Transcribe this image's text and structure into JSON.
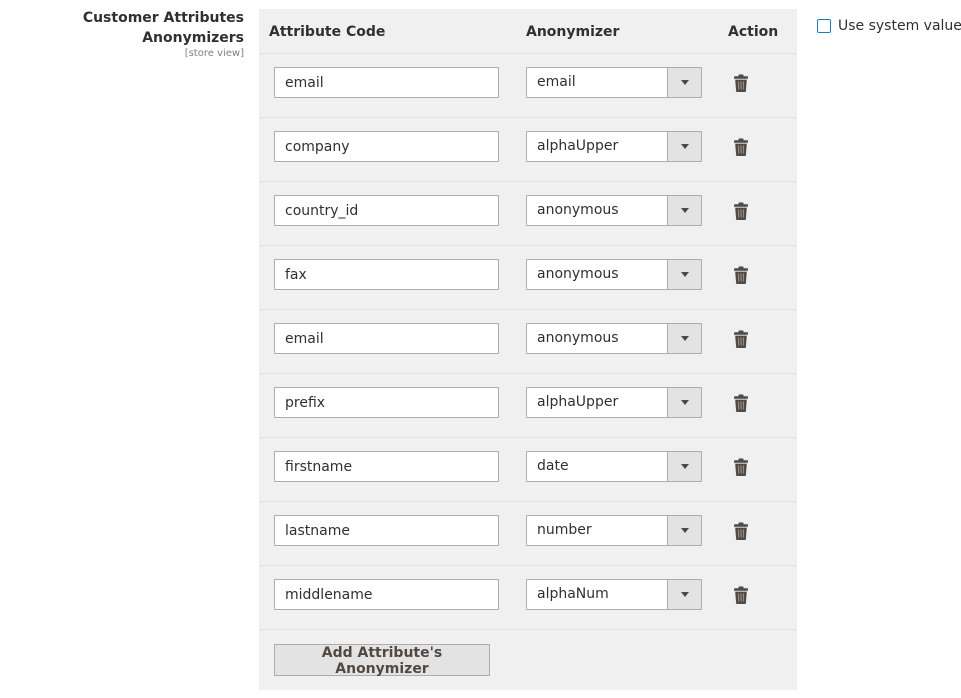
{
  "field": {
    "title": "Customer Attributes Anonymizers",
    "scope": "[store view]"
  },
  "grid": {
    "headers": {
      "code": "Attribute Code",
      "anonymizer": "Anonymizer",
      "action": "Action"
    },
    "rows": [
      {
        "code": "email",
        "anonymizer": "email"
      },
      {
        "code": "company",
        "anonymizer": "alphaUpper"
      },
      {
        "code": "country_id",
        "anonymizer": "anonymous"
      },
      {
        "code": "fax",
        "anonymizer": "anonymous"
      },
      {
        "code": "email",
        "anonymizer": "anonymous"
      },
      {
        "code": "prefix",
        "anonymizer": "alphaUpper"
      },
      {
        "code": "firstname",
        "anonymizer": "date"
      },
      {
        "code": "lastname",
        "anonymizer": "number"
      },
      {
        "code": "middlename",
        "anonymizer": "alphaNum"
      }
    ],
    "add_label": "Add Attribute's Anonymizer"
  },
  "system_value": {
    "label": "Use system value",
    "checked": false
  },
  "icons": {
    "delete": "trash-icon",
    "dropdown": "chevron-down-icon"
  }
}
